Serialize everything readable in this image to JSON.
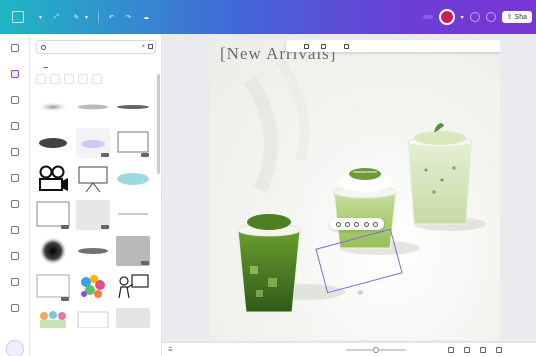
{
  "topbar": {
    "home_label": "",
    "file_label": "",
    "resize_label": "",
    "edit_label": "",
    "pro_label": "",
    "share_label": "Sha"
  },
  "rail": {
    "items": [
      {
        "icon": "design-icon",
        "label": ""
      },
      {
        "icon": "elements-icon",
        "label": ""
      },
      {
        "icon": "text-icon",
        "label": ""
      },
      {
        "icon": "brand-icon",
        "label": ""
      },
      {
        "icon": "uploads-icon",
        "label": ""
      },
      {
        "icon": "draw-icon",
        "label": ""
      },
      {
        "icon": "projects-icon",
        "label": ""
      },
      {
        "icon": "apps-icon",
        "label": ""
      },
      {
        "icon": "charts-icon",
        "label": ""
      },
      {
        "icon": "photos-icon",
        "label": ""
      },
      {
        "icon": "more-icon",
        "label": ""
      }
    ]
  },
  "panel": {
    "search_value": "",
    "tabs": [
      "",
      "",
      "",
      "",
      "",
      ""
    ],
    "filters": [
      "",
      "",
      "",
      "",
      ""
    ]
  },
  "canvas": {
    "heading": "[New Arrivals]",
    "context_toolbar": [
      "",
      "",
      "",
      "",
      "",
      "",
      ""
    ]
  },
  "bottombar": {
    "notes_label": "",
    "zoom_value": "",
    "zoom_level": 0.5
  },
  "colors": {
    "topbar_start": "#20b7c4",
    "topbar_end": "#7a35d4",
    "selection": "#8a63e0",
    "avatar": "#c81e5a"
  }
}
